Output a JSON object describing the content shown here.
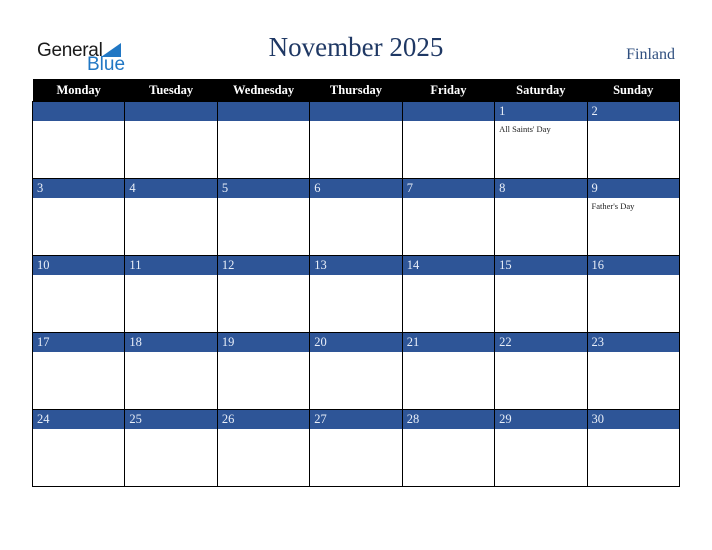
{
  "logo": {
    "line1": "General",
    "line2": "Blue"
  },
  "header": {
    "title": "November 2025",
    "country": "Finland"
  },
  "weekdays": [
    "Monday",
    "Tuesday",
    "Wednesday",
    "Thursday",
    "Friday",
    "Saturday",
    "Sunday"
  ],
  "weeks": [
    [
      {
        "day": "",
        "holiday": ""
      },
      {
        "day": "",
        "holiday": ""
      },
      {
        "day": "",
        "holiday": ""
      },
      {
        "day": "",
        "holiday": ""
      },
      {
        "day": "",
        "holiday": ""
      },
      {
        "day": "1",
        "holiday": "All Saints' Day"
      },
      {
        "day": "2",
        "holiday": ""
      }
    ],
    [
      {
        "day": "3",
        "holiday": ""
      },
      {
        "day": "4",
        "holiday": ""
      },
      {
        "day": "5",
        "holiday": ""
      },
      {
        "day": "6",
        "holiday": ""
      },
      {
        "day": "7",
        "holiday": ""
      },
      {
        "day": "8",
        "holiday": ""
      },
      {
        "day": "9",
        "holiday": "Father's Day"
      }
    ],
    [
      {
        "day": "10",
        "holiday": ""
      },
      {
        "day": "11",
        "holiday": ""
      },
      {
        "day": "12",
        "holiday": ""
      },
      {
        "day": "13",
        "holiday": ""
      },
      {
        "day": "14",
        "holiday": ""
      },
      {
        "day": "15",
        "holiday": ""
      },
      {
        "day": "16",
        "holiday": ""
      }
    ],
    [
      {
        "day": "17",
        "holiday": ""
      },
      {
        "day": "18",
        "holiday": ""
      },
      {
        "day": "19",
        "holiday": ""
      },
      {
        "day": "20",
        "holiday": ""
      },
      {
        "day": "21",
        "holiday": ""
      },
      {
        "day": "22",
        "holiday": ""
      },
      {
        "day": "23",
        "holiday": ""
      }
    ],
    [
      {
        "day": "24",
        "holiday": ""
      },
      {
        "day": "25",
        "holiday": ""
      },
      {
        "day": "26",
        "holiday": ""
      },
      {
        "day": "27",
        "holiday": ""
      },
      {
        "day": "28",
        "holiday": ""
      },
      {
        "day": "29",
        "holiday": ""
      },
      {
        "day": "30",
        "holiday": ""
      }
    ]
  ],
  "colors": {
    "accent": "#2e5597",
    "title": "#1f3864",
    "logo_blue": "#2077c4"
  }
}
